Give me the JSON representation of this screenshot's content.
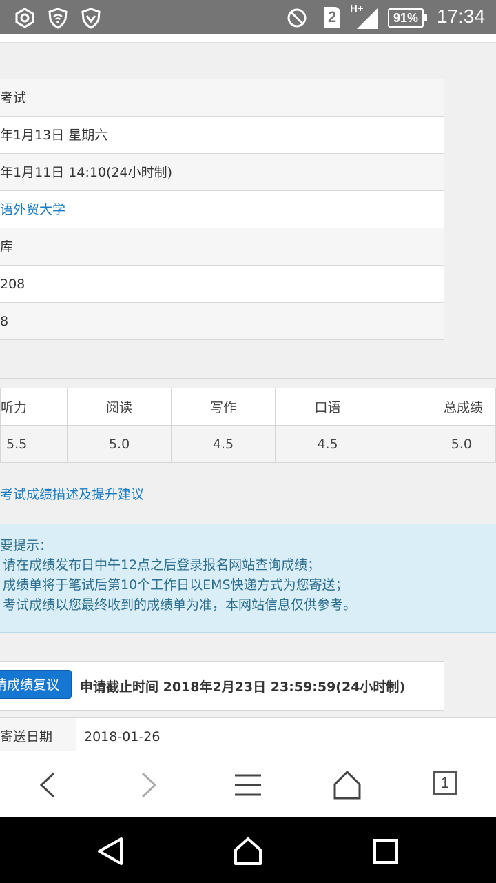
{
  "status_bar": {
    "icons_left": [
      "hexagon-icon",
      "shield-wifi-icon",
      "shield-check-icon"
    ],
    "icons_right": [
      "no-disturb-icon",
      "sim-icon",
      "signal-icon",
      "battery-icon"
    ],
    "sim": "2",
    "network": "H+",
    "battery": "91%",
    "time": "17:34"
  },
  "exam_info": {
    "rows": [
      {
        "text": "考试",
        "style": "normal"
      },
      {
        "text": "年1月13日 星期六",
        "style": "normal"
      },
      {
        "text": "年1月11日 14:10(24小时制)",
        "style": "normal"
      },
      {
        "text": "语外贸大学",
        "style": "link"
      },
      {
        "text": "库",
        "style": "normal"
      },
      {
        "text": "208",
        "style": "normal"
      },
      {
        "text": "8",
        "style": "normal"
      }
    ]
  },
  "scores": {
    "headers": [
      "听力",
      "阅读",
      "写作",
      "口语",
      "总成绩"
    ],
    "values": [
      "5.5",
      "5.0",
      "4.5",
      "4.5",
      "5.0"
    ]
  },
  "advice_link": "考试成绩描述及提升建议",
  "notice": {
    "title": "要提示：",
    "lines": [
      "请在成绩发布日中午12点之后登录报名网站查询成绩；",
      "成绩单将于笔试后第10个工作日以EMS快递方式为您寄送；",
      "考试成绩以您最终收到的成绩单为准，本网站信息仅供参考。"
    ]
  },
  "review": {
    "button_label": "请成绩复议",
    "deadline": "申请截止时间 2018年2月23日 23:59:59(24小时制)"
  },
  "mail": {
    "label": "寄送日期",
    "value": "2018-01-26"
  },
  "browser_toolbar": {
    "tab_count": "1",
    "icons": [
      "back-icon",
      "forward-icon",
      "menu-icon",
      "home-icon",
      "tabs-icon"
    ]
  },
  "android_nav": {
    "icons": [
      "back-triangle-icon",
      "home-house-icon",
      "recents-square-icon"
    ]
  }
}
